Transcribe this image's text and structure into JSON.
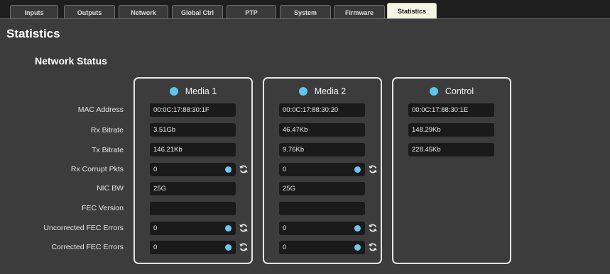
{
  "tabs": [
    {
      "label": "Inputs",
      "active": false
    },
    {
      "label": "Outputs",
      "active": false
    },
    {
      "label": "Network",
      "active": false
    },
    {
      "label": "Global Ctrl",
      "active": false
    },
    {
      "label": "PTP",
      "active": false
    },
    {
      "label": "System",
      "active": false
    },
    {
      "label": "Firmware",
      "active": false
    },
    {
      "label": "Statistics",
      "active": true
    }
  ],
  "page": {
    "title": "Statistics",
    "section_title": "Network Status"
  },
  "row_labels": [
    "MAC Address",
    "Rx Bitrate",
    "Tx Bitrate",
    "Rx Corrupt Pkts",
    "NIC BW",
    "FEC Version",
    "Uncorrected FEC Errors",
    "Corrected FEC Errors"
  ],
  "panels": [
    {
      "title": "Media 1",
      "status_color": "#5ec6ee",
      "mac_address": "00:0C:17:88:30:1F",
      "rx_bitrate": "3.51Gb",
      "tx_bitrate": "146.21Kb",
      "rx_corrupt_pkts": "0",
      "nic_bw": "25G",
      "fec_version": "",
      "uncorrected_fec_errors": "0",
      "corrected_fec_errors": "0"
    },
    {
      "title": "Media 2",
      "status_color": "#5ec6ee",
      "mac_address": "00:0C:17:88:30:20",
      "rx_bitrate": "46.47Kb",
      "tx_bitrate": "9.76Kb",
      "rx_corrupt_pkts": "0",
      "nic_bw": "25G",
      "fec_version": "",
      "uncorrected_fec_errors": "0",
      "corrected_fec_errors": "0"
    },
    {
      "title": "Control",
      "status_color": "#5ec6ee",
      "mac_address": "00:0C:17:88:30:1E",
      "rx_bitrate": "148.29Kb",
      "tx_bitrate": "228.45Kb"
    }
  ],
  "icons": {
    "status_led": "status-led-icon",
    "counter_indicator": "indicator-dot-icon",
    "reset": "refresh-icon"
  },
  "colors": {
    "background": "#3c3c3c",
    "active_tab": "#f4f5e2",
    "led": "#5ec6ee",
    "field": "#1a1a1a"
  }
}
